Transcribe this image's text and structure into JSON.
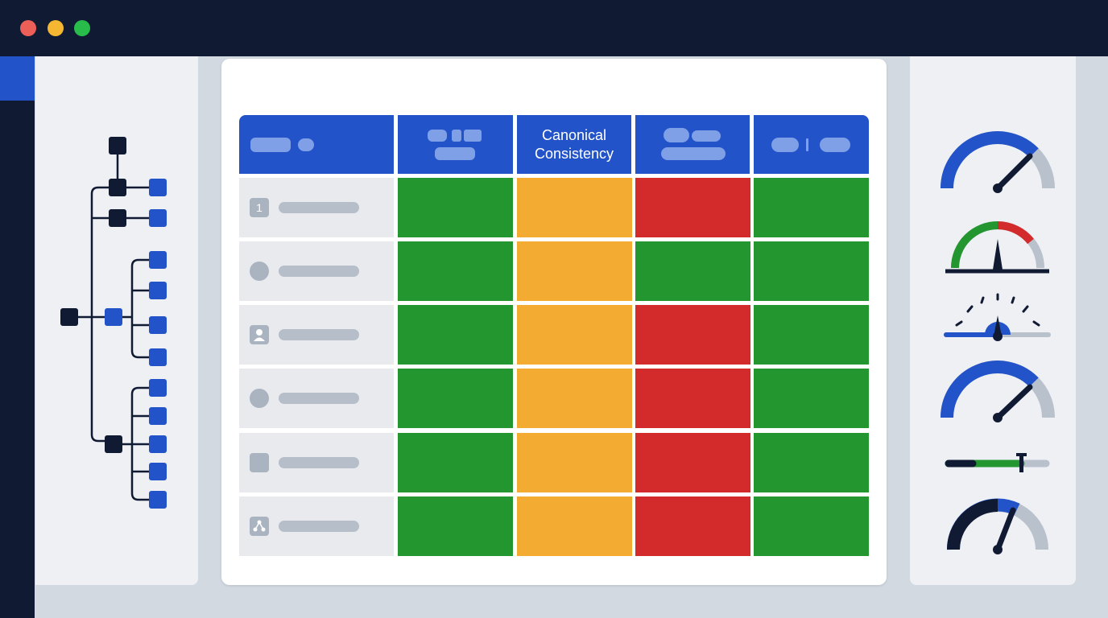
{
  "window": {
    "controls": [
      {
        "name": "close",
        "color": "#ec5f58"
      },
      {
        "name": "minimize",
        "color": "#f5b731"
      },
      {
        "name": "maximize",
        "color": "#28bd4b"
      }
    ]
  },
  "colors": {
    "titlebar": "#111a33",
    "accent": "#2353c9",
    "pass": "#24962f",
    "warn": "#f4ab32",
    "fail": "#d32b2b"
  },
  "table": {
    "headers": [
      {
        "label": "",
        "icon": "redacted-label"
      },
      {
        "label": "",
        "icon": "redacted-label"
      },
      {
        "label": "Canonical\nConsistency"
      },
      {
        "label": "",
        "icon": "redacted-label"
      },
      {
        "label": "",
        "icon": "redacted-label"
      }
    ],
    "rows": [
      {
        "icon": "number-badge",
        "icon_text": "1",
        "cells": [
          "pass",
          "warn",
          "fail",
          "pass"
        ]
      },
      {
        "icon": "circle-avatar",
        "cells": [
          "pass",
          "warn",
          "pass",
          "pass"
        ]
      },
      {
        "icon": "user-icon",
        "cells": [
          "pass",
          "warn",
          "fail",
          "pass"
        ]
      },
      {
        "icon": "circle-avatar",
        "cells": [
          "pass",
          "warn",
          "fail",
          "pass"
        ]
      },
      {
        "icon": "square-placeholder",
        "cells": [
          "pass",
          "warn",
          "fail",
          "pass"
        ]
      },
      {
        "icon": "network-icon",
        "cells": [
          "pass",
          "warn",
          "fail",
          "pass"
        ]
      }
    ]
  },
  "tree": {
    "icon": "hierarchy-tree-icon"
  },
  "gauges": [
    {
      "icon": "speedometer-gauge-icon",
      "level": 0.78
    },
    {
      "icon": "status-meter-icon",
      "level": 0.5
    },
    {
      "icon": "dial-meter-icon",
      "level": 0.5
    },
    {
      "icon": "speedometer-gauge-icon",
      "level": 0.78
    },
    {
      "icon": "progress-slider-icon",
      "level": 0.75
    },
    {
      "icon": "speedometer-gauge-icon",
      "level": 0.62
    }
  ]
}
